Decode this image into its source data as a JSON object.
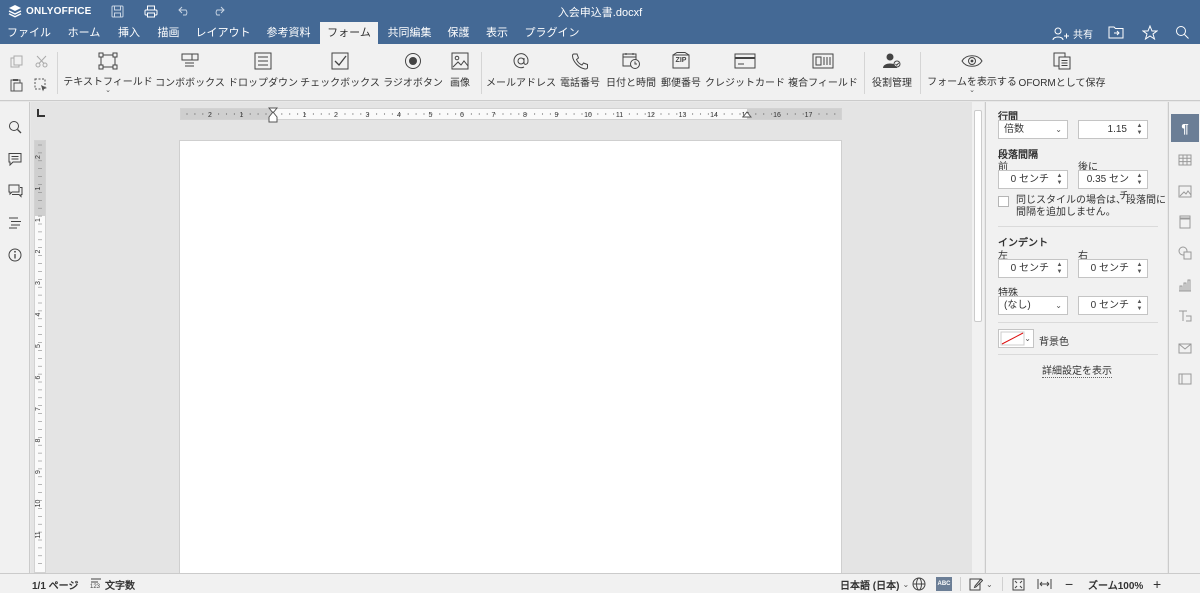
{
  "app": {
    "logo_text": "ONLYOFFICE",
    "document_title": "入会申込書.docxf"
  },
  "menu": {
    "tabs": [
      "ファイル",
      "ホーム",
      "挿入",
      "描画",
      "レイアウト",
      "参考資料",
      "フォーム",
      "共同編集",
      "保護",
      "表示",
      "プラグイン"
    ],
    "active_tab": "フォーム",
    "share_label": "共有"
  },
  "toolbar": {
    "text_field": "テキストフィールド",
    "combo_box": "コンボボックス",
    "dropdown": "ドロップダウン",
    "checkbox": "チェックボックス",
    "radio_button": "ラジオボタン",
    "image": "画像",
    "email": "メールアドレス",
    "phone": "電話番号",
    "date_time": "日付と時間",
    "zip_code": "郵便番号",
    "credit_card": "クレジットカード",
    "complex_field": "複合フィールド",
    "manage_roles": "役割管理",
    "view_form": "フォームを表示する",
    "save_oform": "OFORMとして保存",
    "zip_icon_text": "ZIP"
  },
  "ruler": {
    "h_labels": [
      "2",
      "1",
      "1",
      "2",
      "3",
      "4",
      "5",
      "6",
      "7",
      "8",
      "9",
      "10",
      "11",
      "12",
      "13",
      "14",
      "15",
      "16",
      "17"
    ],
    "v_labels": [
      "2",
      "1",
      "1",
      "2",
      "3",
      "4",
      "5",
      "6",
      "7",
      "8",
      "9",
      "10",
      "11"
    ]
  },
  "paragraph_panel": {
    "line_spacing_label": "行間",
    "line_spacing_mode": "倍数",
    "line_spacing_value": "1.15",
    "para_spacing_label": "段落間隔",
    "before_label": "前",
    "before_value": "0 センチ",
    "after_label": "後に",
    "after_value": "0.35 センチ",
    "same_style_label_1": "同じスタイルの場合は、段落間に",
    "same_style_label_2": "間隔を追加しません。",
    "same_style_checked": false,
    "indent_label": "インデント",
    "left_label": "左",
    "left_value": "0 センチ",
    "right_label": "右",
    "right_value": "0 センチ",
    "special_label": "特殊",
    "special_mode": "(なし)",
    "special_value": "0 センチ",
    "background_label": "背景色",
    "advanced_link": "詳細設定を表示"
  },
  "status": {
    "page_info": "1/1 ページ",
    "word_count": "文字数",
    "word_count_icon_text": "123",
    "language": "日本語 (日本)",
    "spellcheck_icon_text": "ABC",
    "zoom_label": "ズーム100%"
  },
  "colors": {
    "brand": "#446995",
    "toolbar_bg": "#f1f1f1",
    "active_panel_icon": "#6b7e96"
  }
}
